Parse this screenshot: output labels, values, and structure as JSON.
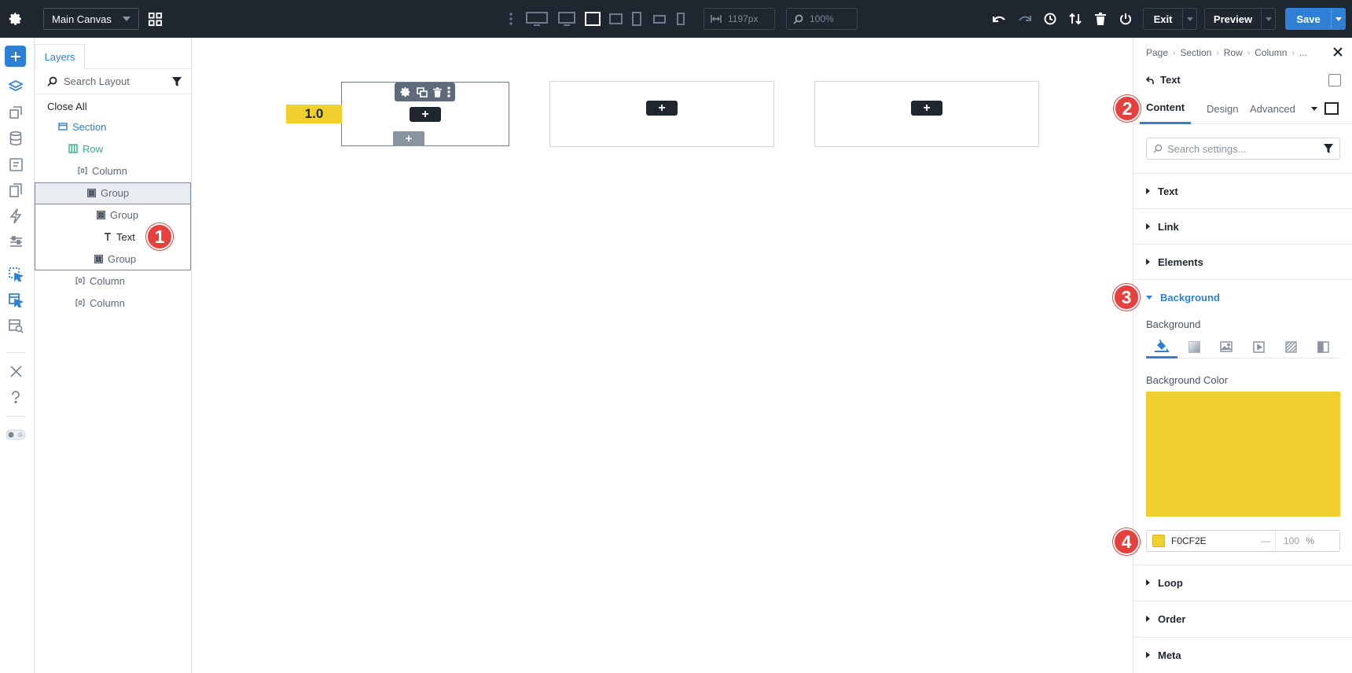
{
  "colors": {
    "topbar_bg": "#1f2630",
    "accent": "#2f80d4",
    "layer_green": "#33b08a",
    "module_bg": "#f0cf2e",
    "marker_red": "#e5403d"
  },
  "topbar": {
    "canvas_name": "Main Canvas",
    "width_value": "1197px",
    "zoom_value": "100%",
    "exit_label": "Exit",
    "preview_label": "Preview",
    "save_label": "Save",
    "icons": [
      "gear-icon",
      "grid-icon",
      "more-vertical-icon",
      "monitor-wide-icon",
      "monitor-icon",
      "laptop-icon",
      "tablet-landscape-icon",
      "tablet-icon",
      "phone-landscape-icon",
      "phone-icon",
      "width-icon",
      "zoom-icon",
      "undo-icon",
      "redo-icon",
      "history-icon",
      "sort-icon",
      "trash-icon",
      "power-icon"
    ]
  },
  "layers": {
    "tab_label": "Layers",
    "search_placeholder": "Search Layout",
    "close_all": "Close All",
    "tree": [
      {
        "label": "Section",
        "type": "section"
      },
      {
        "label": "Row",
        "type": "row"
      },
      {
        "label": "Column",
        "type": "column"
      },
      {
        "label": "Group",
        "type": "group",
        "selected": true
      },
      {
        "label": "Group",
        "type": "group"
      },
      {
        "label": "Text",
        "type": "text"
      },
      {
        "label": "Group",
        "type": "group"
      },
      {
        "label": "Column",
        "type": "column"
      },
      {
        "label": "Column",
        "type": "column"
      }
    ]
  },
  "canvas": {
    "text_module_value": "1.0",
    "plus": "+"
  },
  "settings": {
    "breadcrumb": [
      "Page",
      "Section",
      "Row",
      "Column",
      "..."
    ],
    "module_title": "Text",
    "tabs": [
      "Content",
      "Design",
      "Advanced"
    ],
    "active_tab": "Content",
    "search_placeholder": "Search settings...",
    "sections": {
      "text": "Text",
      "link": "Link",
      "elements": "Elements",
      "background": "Background",
      "loop": "Loop",
      "order": "Order",
      "meta": "Meta"
    },
    "background_label": "Background",
    "background_color_label": "Background Color",
    "background_types": [
      "color-fill-icon",
      "gradient-icon",
      "image-icon",
      "video-icon",
      "pattern-icon",
      "mask-icon"
    ],
    "color_hex": "F0CF2E",
    "color_swatch": "#f0cf2e",
    "opacity_dash": "—",
    "opacity_value": "100",
    "opacity_unit": "%"
  },
  "markers": [
    "1",
    "2",
    "3",
    "4"
  ]
}
